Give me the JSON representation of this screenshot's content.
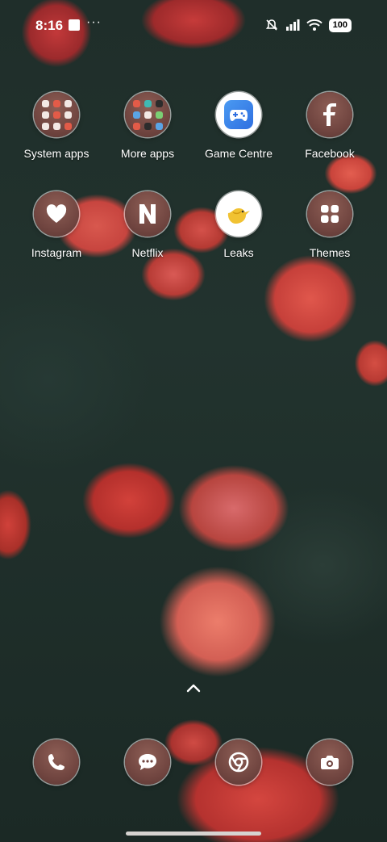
{
  "status": {
    "time": "8:16",
    "more": "···",
    "battery": "100"
  },
  "apps_row1": [
    {
      "label": "System apps",
      "icon": "folder-icon"
    },
    {
      "label": "More apps",
      "icon": "folder-icon"
    },
    {
      "label": "Game Centre",
      "icon": "gamepad-icon"
    },
    {
      "label": "Facebook",
      "icon": "facebook-icon"
    }
  ],
  "apps_row2": [
    {
      "label": "Instagram",
      "icon": "heart-icon"
    },
    {
      "label": "Netflix",
      "icon": "netflix-icon"
    },
    {
      "label": "Leaks",
      "icon": "bird-icon"
    },
    {
      "label": "Themes",
      "icon": "grid-icon"
    }
  ],
  "dock": [
    {
      "name": "Phone",
      "icon": "phone-icon"
    },
    {
      "name": "Messages",
      "icon": "message-icon"
    },
    {
      "name": "Chrome",
      "icon": "chrome-icon"
    },
    {
      "name": "Camera",
      "icon": "camera-icon"
    }
  ],
  "colors": {
    "icon_fill": "#6f443f",
    "game_centre": "#3b7fe6",
    "leaks": "#f1c232"
  }
}
